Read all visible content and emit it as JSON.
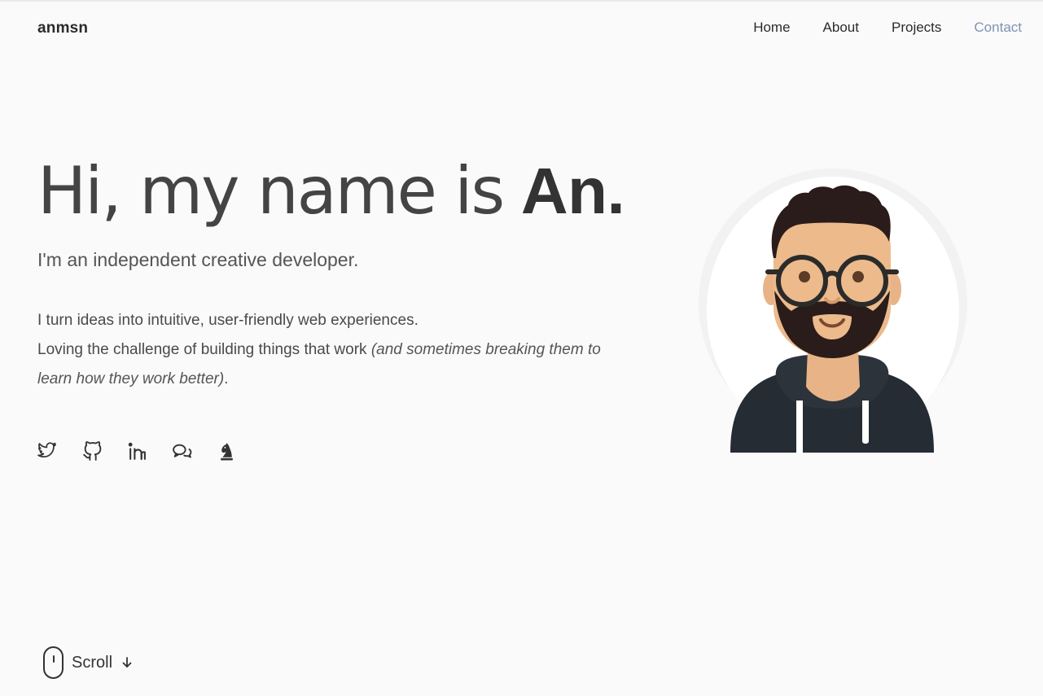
{
  "brand": {
    "logo": "anmsn"
  },
  "nav": {
    "items": [
      {
        "label": "Home"
      },
      {
        "label": "About"
      },
      {
        "label": "Projects"
      },
      {
        "label": "Contact"
      }
    ],
    "active_color": "#7f93b5"
  },
  "hero": {
    "greeting": "Hi, my name is",
    "name": "An.",
    "subtitle": "I'm an independent creative developer.",
    "bio_line1": "I turn ideas into intuitive, user-friendly web experiences.",
    "bio_line2": "Loving the challenge of building things that work ",
    "bio_italic": "(and sometimes breaking them to learn how they work better)",
    "bio_end": "."
  },
  "socials": [
    {
      "icon": "twitter-icon"
    },
    {
      "icon": "github-icon"
    },
    {
      "icon": "linkedin-icon"
    },
    {
      "icon": "chat-icon"
    },
    {
      "icon": "chess-knight-icon"
    }
  ],
  "scroll": {
    "label": "Scroll"
  }
}
